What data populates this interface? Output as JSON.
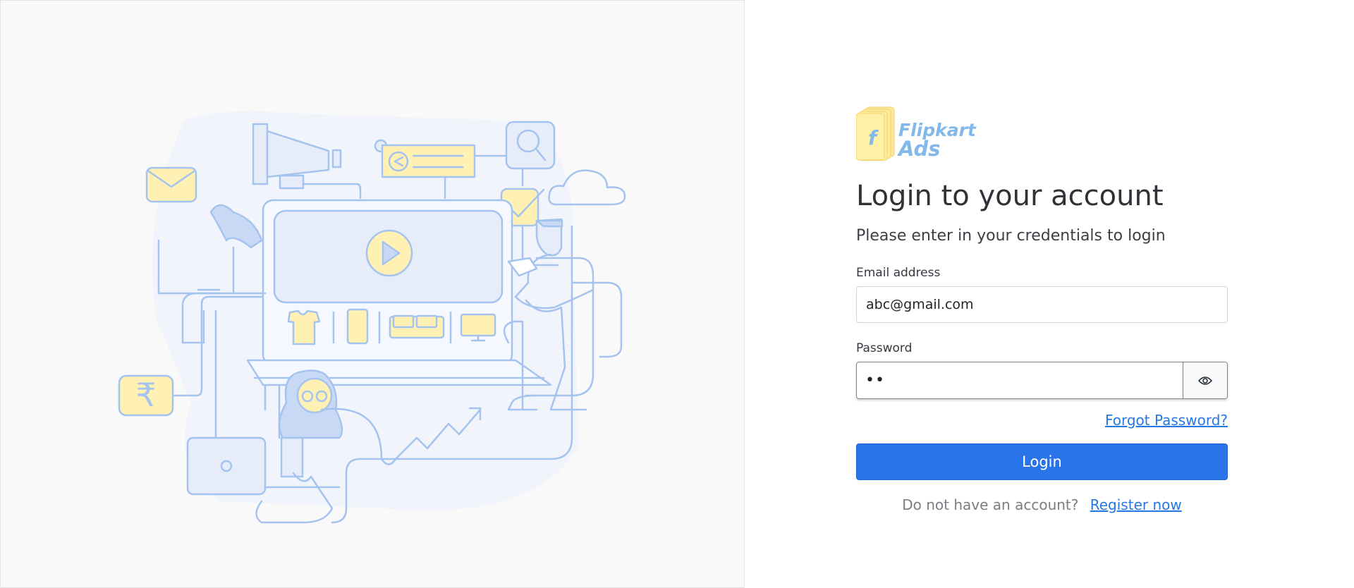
{
  "brand": {
    "logo_line1": "Flipkart",
    "logo_line2": "Ads",
    "accent_color": "#82b9ea"
  },
  "login_form": {
    "title": "Login to your account",
    "subtitle": "Please enter in your credentials to login",
    "email_label": "Email address",
    "email_value": "abc@gmail.com",
    "password_label": "Password",
    "password_value": "••",
    "show_password_icon": "eye-icon",
    "forgot_password_link": "Forgot Password?",
    "login_button": "Login",
    "register_prompt": "Do not have an account?",
    "register_link": "Register now"
  },
  "colors": {
    "primary_button": "#2a74ea",
    "link": "#2577e3",
    "illustration_blue": "#a5c3ef",
    "illustration_yellow": "#fff0b3"
  }
}
